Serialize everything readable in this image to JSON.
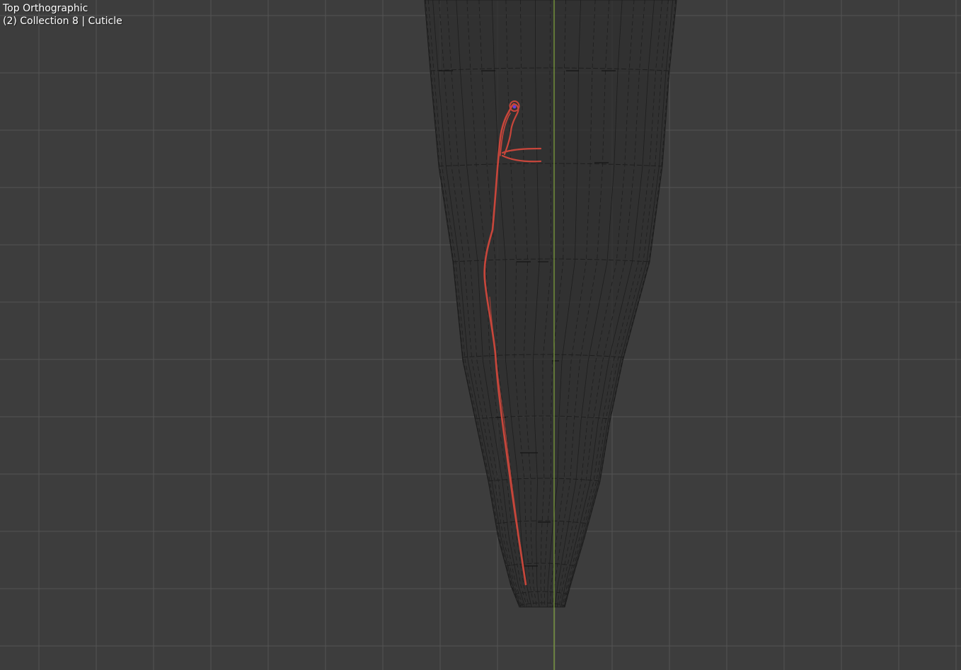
{
  "viewport": {
    "view_name": "Top Orthographic",
    "collection_info": "(2) Collection 8 | Cuticle"
  },
  "colors": {
    "background": "#3d3d3d",
    "grid_minor": "#474747",
    "grid_major": "#545454",
    "y_axis": "#7fa43a",
    "mesh_fill": "#2e2e2e",
    "mesh_wire": "#1e1e1e",
    "selected_curve": "#c8463b",
    "active_origin": "#6a3fd8"
  },
  "icons": {
    "object_origin": "origin-dot-icon"
  }
}
